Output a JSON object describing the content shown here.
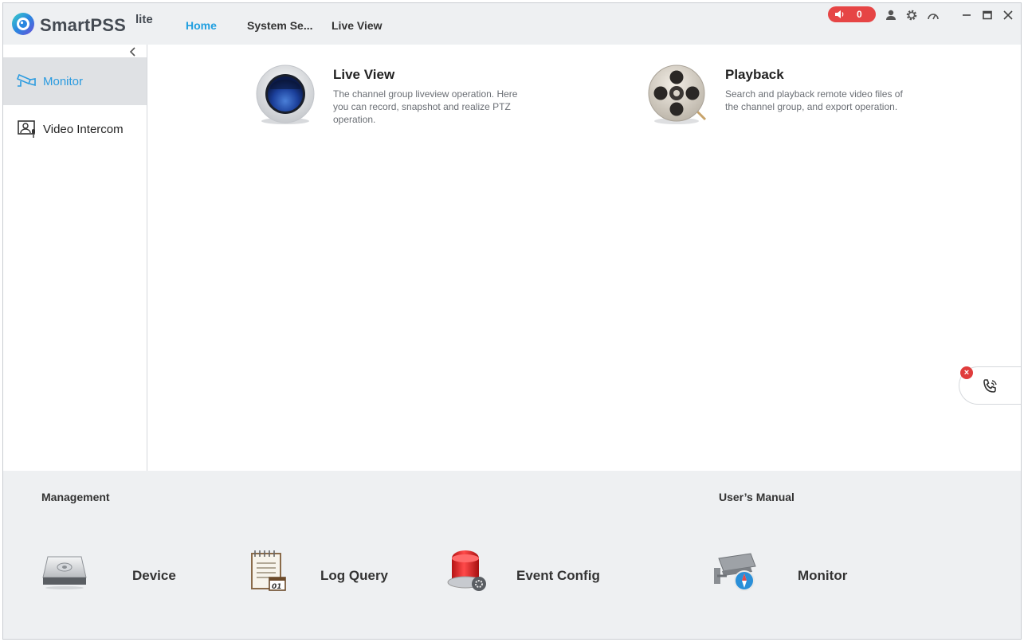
{
  "app": {
    "brand": "SmartPSS",
    "brand_sup": "lite"
  },
  "nav": [
    {
      "label": "Home",
      "active": true
    },
    {
      "label": "System Se...",
      "active": false
    },
    {
      "label": "Live View",
      "active": false
    }
  ],
  "titlebar": {
    "alarm_count": "0",
    "icons": [
      "speaker-icon",
      "user-icon",
      "gear-icon",
      "gauge-icon",
      "minimize-icon",
      "maximize-icon",
      "close-icon"
    ]
  },
  "sidebar": {
    "items": [
      {
        "label": "Monitor",
        "icon": "monitor-camera-icon",
        "active": true
      },
      {
        "label": "Video Intercom",
        "icon": "video-intercom-icon",
        "active": false
      }
    ]
  },
  "main": {
    "cards": [
      {
        "title": "Live View",
        "description": "The channel group liveview operation. Here you can record, snapshot and realize PTZ operation.",
        "icon": "live-view-lens-icon"
      },
      {
        "title": "Playback",
        "description": "Search and playback remote video files of the channel group, and export operation.",
        "icon": "film-reel-icon"
      }
    ]
  },
  "bottom": {
    "management_title": "Management",
    "manual_title": "User’s Manual",
    "tools": [
      {
        "label": "Device",
        "icon": "device-icon"
      },
      {
        "label": "Log Query",
        "icon": "log-query-icon"
      },
      {
        "label": "Event Config",
        "icon": "alarm-light-icon"
      },
      {
        "label": "Monitor",
        "icon": "camera-compass-icon"
      }
    ]
  },
  "colors": {
    "accent": "#1f9fe0",
    "alarm": "#e64545",
    "panel_bg": "#eef0f2"
  }
}
